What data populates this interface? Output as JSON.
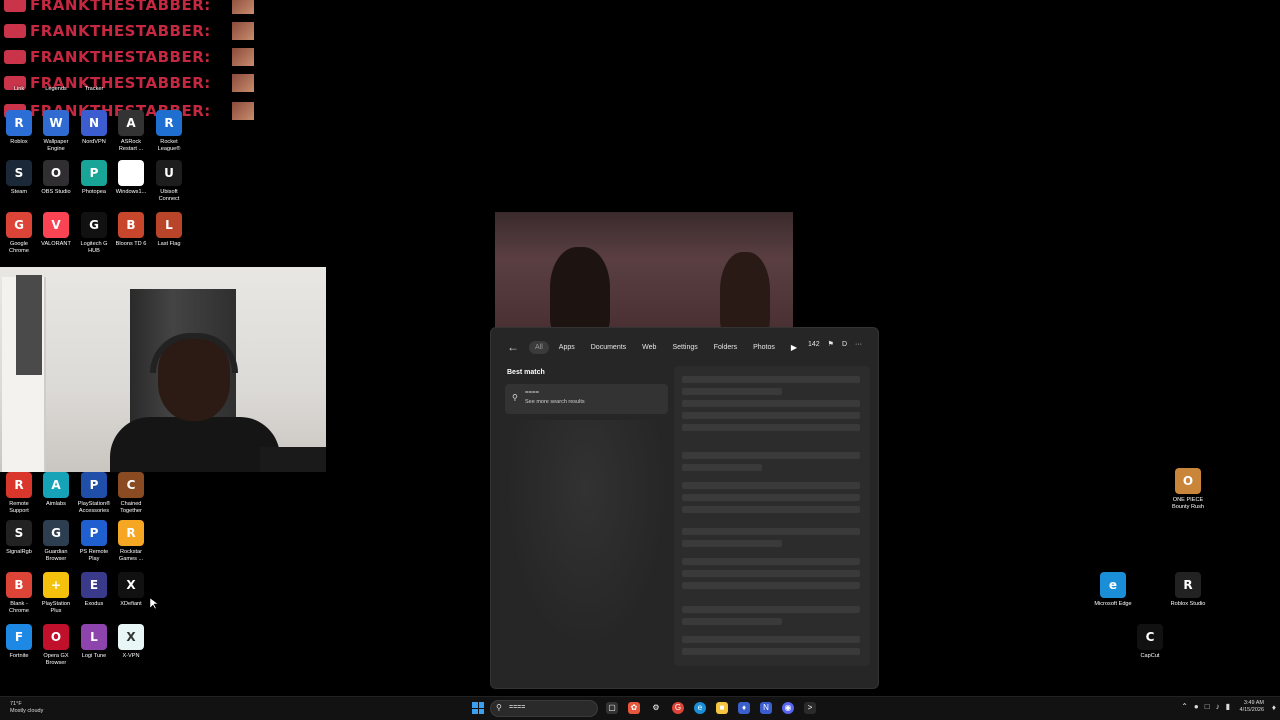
{
  "overlay": {
    "banner_text": "FRANKTHESTABBER:"
  },
  "desktop": {
    "icons_left": [
      {
        "label": "Roblox",
        "color": "#2b6fd6",
        "glyph": "R"
      },
      {
        "label": "Wallpaper Engine",
        "color": "#2f6bd1",
        "glyph": "W"
      },
      {
        "label": "NordVPN",
        "color": "#3b5dd0",
        "glyph": "N"
      },
      {
        "label": "ASRock Restart ...",
        "color": "#333333",
        "glyph": "A"
      },
      {
        "label": "Rocket League®",
        "color": "#1f6fd1",
        "glyph": "R"
      },
      {
        "label": "Steam",
        "color": "#1b2838",
        "glyph": "S"
      },
      {
        "label": "OBS Studio",
        "color": "#302e31",
        "glyph": "O"
      },
      {
        "label": "Photopea",
        "color": "#18a497",
        "glyph": "P"
      },
      {
        "label": "Windows1...",
        "color": "#ffffff",
        "glyph": ""
      },
      {
        "label": "Ubisoft Connect",
        "color": "#1d1d1d",
        "glyph": "U"
      },
      {
        "label": "Google Chrome",
        "color": "#db4437",
        "glyph": "G"
      },
      {
        "label": "VALORANT",
        "color": "#fa4454",
        "glyph": "V"
      },
      {
        "label": "Logitech G HUB",
        "color": "#111111",
        "glyph": "G"
      },
      {
        "label": "Bloons TD 6",
        "color": "#c8472c",
        "glyph": "B"
      },
      {
        "label": "Last Flag",
        "color": "#b8442a",
        "glyph": "L"
      },
      {
        "label": "Remote Support",
        "color": "#d9362c",
        "glyph": "R"
      },
      {
        "label": "Aimlabs",
        "color": "#16a3b8",
        "glyph": "A"
      },
      {
        "label": "PlayStation® Accessories",
        "color": "#1f4fa8",
        "glyph": "P"
      },
      {
        "label": "Chained Together",
        "color": "#8a4b22",
        "glyph": "C"
      },
      {
        "label": "SignalRgb",
        "color": "#222222",
        "glyph": "S"
      },
      {
        "label": "Guardian Browser",
        "color": "#2d3e50",
        "glyph": "G"
      },
      {
        "label": "PS Remote Play",
        "color": "#1f5fd0",
        "glyph": "P"
      },
      {
        "label": "Rockstar Games ...",
        "color": "#f5a623",
        "glyph": "R"
      },
      {
        "label": "Blank - Chrome",
        "color": "#db4437",
        "glyph": "B"
      },
      {
        "label": "PlayStation Plus",
        "color": "#f4c20d",
        "glyph": "+"
      },
      {
        "label": "Exodus",
        "color": "#3a3a8a",
        "glyph": "E"
      },
      {
        "label": "XDefiant",
        "color": "#111111",
        "glyph": "X"
      },
      {
        "label": "Fortnite",
        "color": "#1e88e5",
        "glyph": "F"
      },
      {
        "label": "Opera GX Browser",
        "color": "#c0102c",
        "glyph": "O"
      },
      {
        "label": "Logi Tune",
        "color": "#8e44ad",
        "glyph": "L"
      },
      {
        "label": "X-VPN",
        "color": "#e8f6f6",
        "glyph": "X"
      }
    ],
    "top_row_labels": [
      "Legends",
      "Tracker",
      "Link"
    ],
    "icons_right": [
      {
        "label": "ONE PIECE Bounty Rush",
        "color": "#c9863b",
        "glyph": "O"
      },
      {
        "label": "Microsoft Edge",
        "color": "#1a8fd8",
        "glyph": "e"
      },
      {
        "label": "Roblox Studio",
        "color": "#222222",
        "glyph": "R"
      },
      {
        "label": "CapCut",
        "color": "#111111",
        "glyph": "C"
      }
    ]
  },
  "search_panel": {
    "filters": [
      "All",
      "Apps",
      "Documents",
      "Web",
      "Settings",
      "Folders",
      "Photos"
    ],
    "active_filter": "All",
    "points": "142",
    "user_initial": "D",
    "best_match_label": "Best match",
    "query": "====",
    "see_more": "See more search results"
  },
  "taskbar": {
    "weather_temp": "71°F",
    "weather_desc": "Mostly cloudy",
    "search_text": "====",
    "time": "3:49 AM",
    "date": "4/15/2026"
  }
}
